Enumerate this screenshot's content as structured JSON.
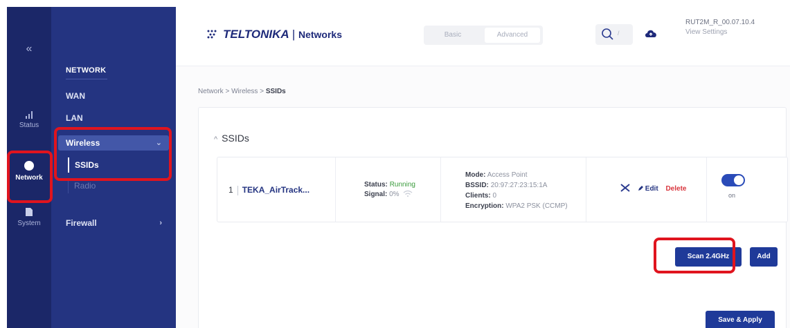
{
  "rail": {
    "collapse": "«",
    "items": [
      {
        "label": "Status",
        "icon": "signal-icon"
      },
      {
        "label": "Network",
        "icon": "globe-icon"
      },
      {
        "label": "System",
        "icon": "document-icon"
      }
    ]
  },
  "nav": {
    "title": "NETWORK",
    "items": {
      "wan": "WAN",
      "lan": "LAN",
      "wireless": "Wireless",
      "ssids": "SSIDs",
      "radio": "Radio",
      "firewall": "Firewall"
    }
  },
  "header": {
    "logo": "TELTONIKA",
    "logo_sep": "|",
    "logo_suffix": "Networks",
    "mode_basic": "Basic",
    "mode_advanced": "Advanced",
    "search_shortcut": "/",
    "firmware": "RUT2M_R_00.07.10.4",
    "view_settings": "View Settings"
  },
  "breadcrumb": {
    "part1": "Network",
    "sep": ">",
    "part2": "Wireless",
    "current": "SSIDs"
  },
  "ssids": {
    "title": "SSIDs",
    "caret": "^",
    "row": {
      "index": "1",
      "name": "TEKA_AirTrack...",
      "status_label": "Status:",
      "status_value": "Running",
      "signal_label": "Signal:",
      "signal_value": "0%",
      "mode_label": "Mode:",
      "mode_value": "Access Point",
      "bssid_label": "BSSID:",
      "bssid_value": "20:97:27:23:15:1A",
      "clients_label": "Clients:",
      "clients_value": "0",
      "encryption_label": "Encryption:",
      "encryption_value": "WPA2 PSK (CCMP)",
      "edit": "Edit",
      "delete": "Delete",
      "toggle_label": "on",
      "enabled": true
    },
    "scan_button": "Scan 2.4GHz",
    "add_button": "Add",
    "save_button": "Save & Apply"
  },
  "colors": {
    "rail": "#1b2768",
    "nav": "#243481",
    "primary": "#1f3a99",
    "highlight": "#e0141e",
    "running": "#3a9b3c",
    "delete": "#d9363e"
  }
}
